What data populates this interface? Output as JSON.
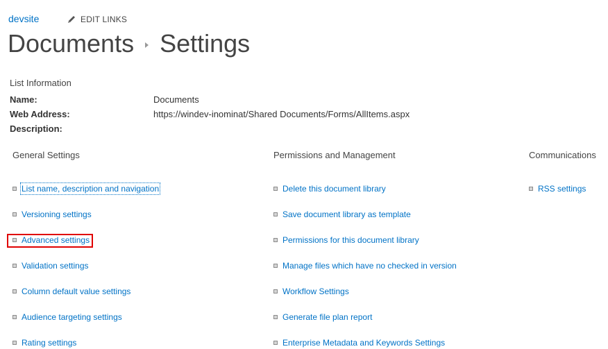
{
  "header": {
    "site_name": "devsite",
    "edit_links_label": "EDIT LINKS",
    "edit_icon": "pencil-icon"
  },
  "breadcrumb": {
    "root": "Documents",
    "current": "Settings",
    "separator_icon": "chevron-right-icon"
  },
  "list_info": {
    "heading": "List Information",
    "name_label": "Name:",
    "name_value": "Documents",
    "web_address_label": "Web Address:",
    "web_address_value": "https://windev-inominat/Shared Documents/Forms/AllItems.aspx",
    "description_label": "Description:",
    "description_value": ""
  },
  "sections": {
    "general": {
      "heading": "General Settings",
      "links": [
        "List name, description and navigation",
        "Versioning settings",
        "Advanced settings",
        "Validation settings",
        "Column default value settings",
        "Audience targeting settings",
        "Rating settings"
      ]
    },
    "permissions": {
      "heading": "Permissions and Management",
      "links": [
        "Delete this document library",
        "Save document library as template",
        "Permissions for this document library",
        "Manage files which have no checked in version",
        "Workflow Settings",
        "Generate file plan report",
        "Enterprise Metadata and Keywords Settings"
      ]
    },
    "communications": {
      "heading": "Communications",
      "links": [
        "RSS settings"
      ]
    }
  },
  "colors": {
    "link": "#0072c6",
    "highlight": "#e00000"
  }
}
